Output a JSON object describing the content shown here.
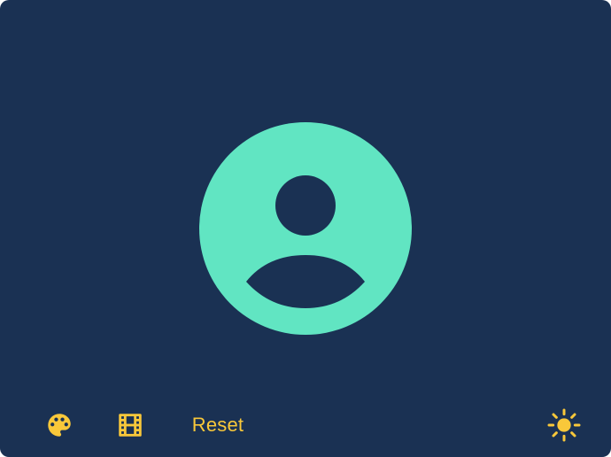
{
  "colors": {
    "background": "#1a3153",
    "avatar": "#61e5c2",
    "accent": "#f9c83a"
  },
  "avatar": {
    "icon": "account-circle-icon"
  },
  "toolbar": {
    "palette_icon": "palette-icon",
    "film_icon": "film-icon",
    "reset_label": "Reset",
    "theme_icon": "sun-icon"
  }
}
